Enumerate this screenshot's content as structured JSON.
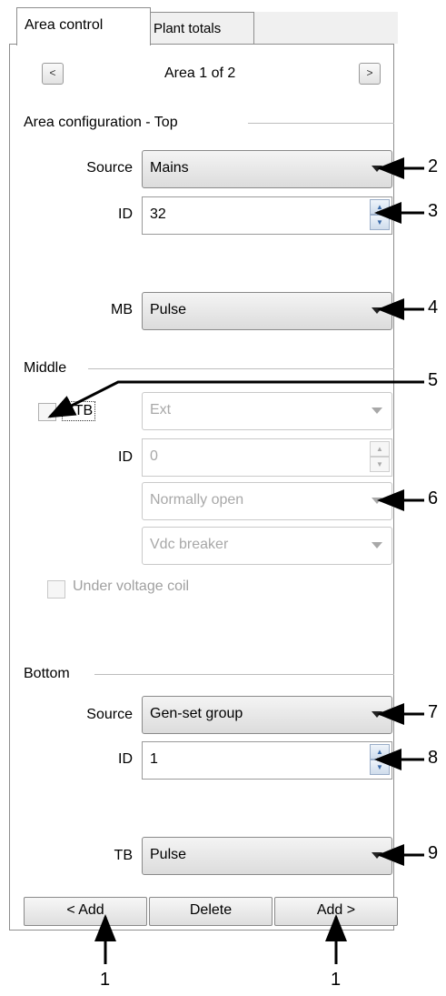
{
  "tabs": {
    "active": "Area control",
    "inactive": "Plant totals"
  },
  "nav": {
    "prev": "<",
    "next": ">",
    "title": "Area 1 of 2"
  },
  "top": {
    "heading": "Area configuration - Top",
    "source_label": "Source",
    "source_value": "Mains",
    "id_label": "ID",
    "id_value": "32",
    "mb_label": "MB",
    "mb_value": "Pulse"
  },
  "middle": {
    "heading": "Middle",
    "btb_label": "BTB",
    "btb_value": "Ext",
    "id_label": "ID",
    "id_value": "0",
    "state_value": "Normally open",
    "breaker_value": "Vdc breaker",
    "uv_label": "Under voltage coil"
  },
  "bottom": {
    "heading": "Bottom",
    "source_label": "Source",
    "source_value": "Gen-set group",
    "id_label": "ID",
    "id_value": "1",
    "tb_label": "TB",
    "tb_value": "Pulse"
  },
  "buttons": {
    "add_left": "< Add",
    "delete": "Delete",
    "add_right": "Add >"
  },
  "callouts": [
    "2",
    "3",
    "4",
    "5",
    "6",
    "7",
    "8",
    "9",
    "1",
    "1"
  ]
}
